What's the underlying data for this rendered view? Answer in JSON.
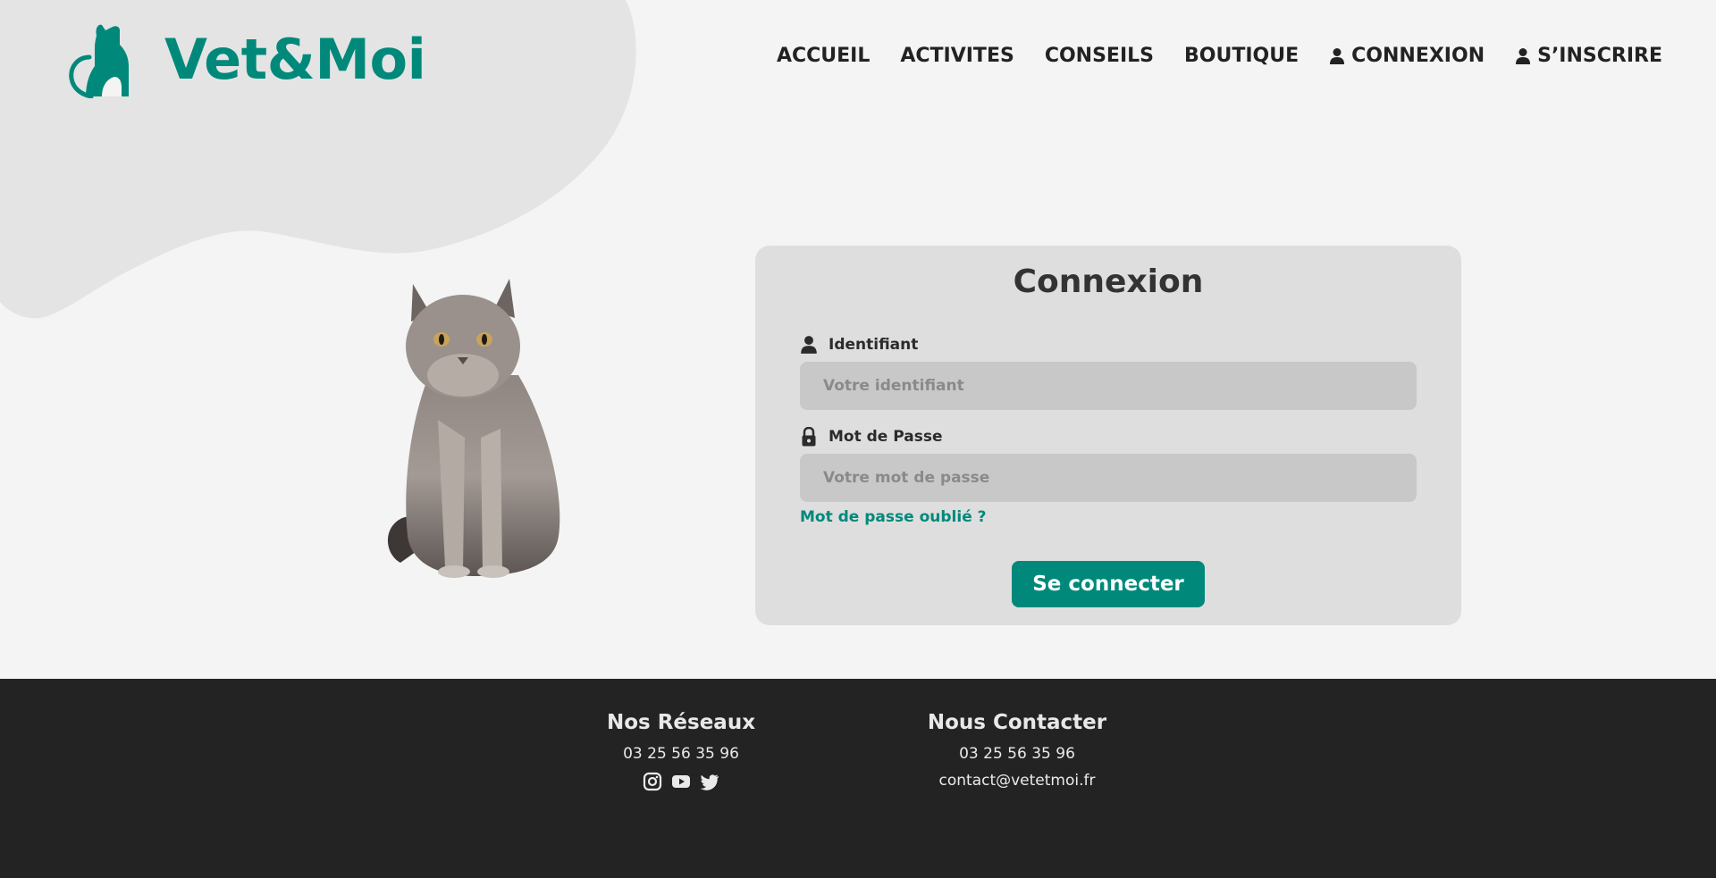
{
  "brand": {
    "name": "Vet&Moi",
    "logo_icon": "cat-logo-icon",
    "color": "#00897b"
  },
  "nav": {
    "items": [
      {
        "label": "ACCUEIL"
      },
      {
        "label": "ACTIVITES"
      },
      {
        "label": "CONSEILS"
      },
      {
        "label": "BOUTIQUE"
      },
      {
        "label": "CONNEXION",
        "icon": "user-icon"
      },
      {
        "label": "S’INSCRIRE",
        "icon": "user-icon"
      }
    ]
  },
  "login": {
    "title": "Connexion",
    "username": {
      "label": "Identifiant",
      "placeholder": "Votre identifiant",
      "value": "",
      "icon": "user-icon"
    },
    "password": {
      "label": "Mot de Passe",
      "placeholder": "Votre mot de passe",
      "value": "",
      "icon": "lock-icon"
    },
    "forgot_label": "Mot de passe oublié ?",
    "submit_label": "Se connecter"
  },
  "footer": {
    "networks": {
      "title": "Nos Réseaux",
      "phone": "03 25 56 35 96",
      "icons": [
        "instagram-icon",
        "youtube-icon",
        "twitter-icon"
      ]
    },
    "contact": {
      "title": "Nous Contacter",
      "phone": "03 25 56 35 96",
      "email": "contact@vetetmoi.fr"
    }
  },
  "colors": {
    "accent": "#00897b",
    "background": "#f4f4f4",
    "card": "#dedede",
    "footer": "#232323"
  }
}
